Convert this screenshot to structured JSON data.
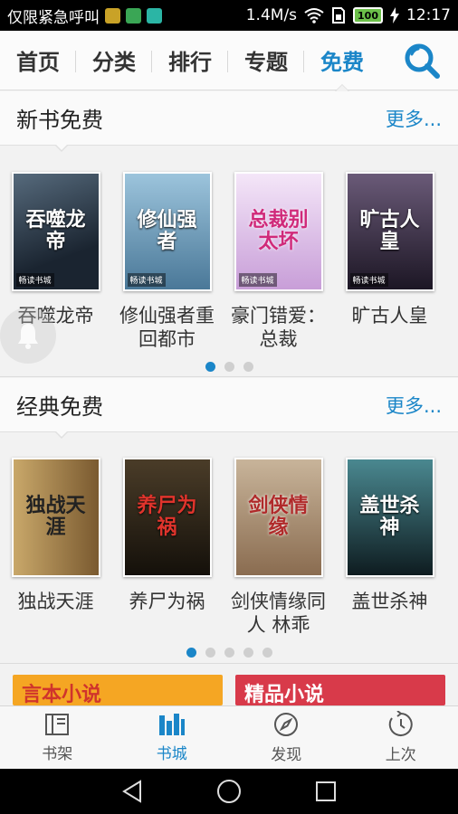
{
  "status_bar": {
    "carrier": "仅限紧急呼叫",
    "speed": "1.4M/s",
    "battery": "100",
    "time": "12:17"
  },
  "top_tabs": [
    "首页",
    "分类",
    "排行",
    "专题",
    "免费"
  ],
  "active_tab": 4,
  "sections": [
    {
      "title": "新书免费",
      "more": "更多...",
      "books": [
        {
          "name": "吞噬龙帝",
          "cover_text": "吞噬龙帝",
          "badge": "畅读书城",
          "cover_color": "#2a3848"
        },
        {
          "name": "修仙强者重回都市",
          "cover_text": "修仙强者",
          "badge": "畅读书城",
          "cover_color": "#6c98b8"
        },
        {
          "name": "豪门错爱：总裁",
          "cover_text": "总裁别太坏",
          "badge": "畅读书城",
          "cover_color": "#c8a0d8"
        },
        {
          "name": "旷古人皇",
          "cover_text": "旷古人皇",
          "badge": "畅读书城",
          "cover_color": "#302838"
        }
      ],
      "pager": {
        "count": 3,
        "active": 0
      }
    },
    {
      "title": "经典免费",
      "more": "更多...",
      "books": [
        {
          "name": "独战天涯",
          "cover_text": "独战天涯",
          "badge": "",
          "cover_color": "#8a6a40"
        },
        {
          "name": "养尸为祸",
          "cover_text": "养尸为祸",
          "badge": "",
          "cover_color": "#2c2418"
        },
        {
          "name": "剑侠情缘同人 林乖",
          "cover_text": "剑侠情缘",
          "badge": "",
          "cover_color": "#a08468"
        },
        {
          "name": "盖世杀神",
          "cover_text": "盖世杀神",
          "badge": "",
          "cover_color": "#1c3438"
        }
      ],
      "pager": {
        "count": 5,
        "active": 0
      }
    }
  ],
  "banners": [
    {
      "text": "言本小说",
      "bg": "#f5a623",
      "fg": "#d0342c"
    },
    {
      "text": "精品小说",
      "bg": "#d83a4a",
      "fg": "#ffffff"
    }
  ],
  "bottom_nav": [
    "书架",
    "书城",
    "发现",
    "上次"
  ],
  "bottom_active": 1,
  "colors": {
    "accent": "#1b86c8"
  }
}
